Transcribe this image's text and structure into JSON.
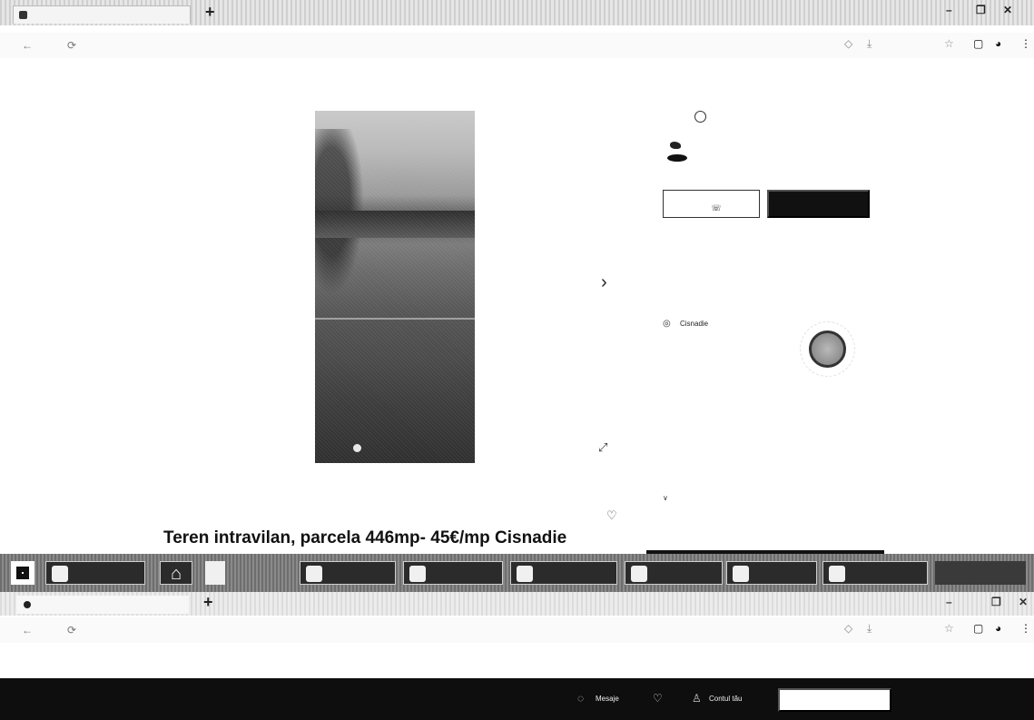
{
  "browser": {
    "tab_title": "",
    "new_tab_icon": "plus-icon",
    "window_controls": {
      "minimize": "–",
      "maximize": "❐",
      "close": "✕"
    },
    "nav": {
      "back": "←",
      "reload": "⟳"
    },
    "url": "",
    "bookmarks_text": "",
    "bookmarks_right": "",
    "ext_icons": [
      "◇",
      "⤓",
      "☆"
    ],
    "ext_dark": [
      "▢",
      "◕",
      "⋮"
    ]
  },
  "listing": {
    "title": "Teren intravilan, parcela 446mp- 45€/mp Cisnadie",
    "caption": "",
    "next_arrow": "›",
    "fullscreen": "⤢",
    "favorite": "♡"
  },
  "seller": {
    "label": "",
    "name": "",
    "subtitle": "",
    "phone_button": "",
    "message_button": "",
    "note": ""
  },
  "location": {
    "heading": "",
    "city": "Cisnadie"
  },
  "description": {
    "heading": "",
    "lines": [
      "",
      ""
    ],
    "more_link": "",
    "more_chevron": "∨"
  },
  "taskbar": {
    "apps": [
      {
        "label": ""
      },
      {
        "label": ""
      },
      {
        "label": ""
      },
      {
        "label": ""
      },
      {
        "label": ""
      },
      {
        "label": ""
      },
      {
        "label": ""
      },
      {
        "label": ""
      }
    ],
    "tray": ""
  },
  "browser2": {
    "tab_title": "",
    "url": "",
    "bookmarks_text": "",
    "bookmarks_right": ""
  },
  "bottom_bar": {
    "logo": "",
    "message_label": "Mesaje",
    "account_label": "Contul tău",
    "cta": ""
  }
}
